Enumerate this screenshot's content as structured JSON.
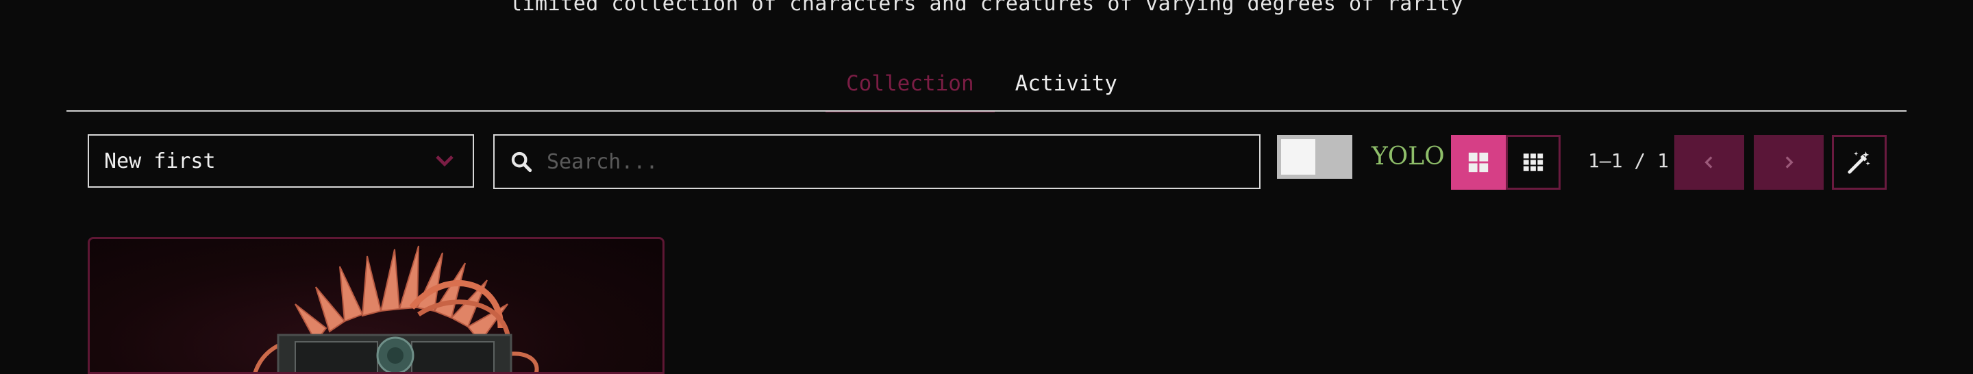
{
  "header": {
    "subtitle": "limited collection of characters and creatures of varying degrees of rarity"
  },
  "tabs": [
    {
      "label": "Collection",
      "active": true
    },
    {
      "label": "Activity",
      "active": false
    }
  ],
  "toolbar": {
    "sort": {
      "selected": "New first",
      "icon": "chevron-down-icon"
    },
    "search": {
      "placeholder": "Search...",
      "value": "",
      "icon": "search-icon"
    },
    "yolo_toggle": {
      "label": "YOLO",
      "on": false
    },
    "view_modes": [
      {
        "name": "large-grid",
        "icon": "grid-large-icon",
        "active": true
      },
      {
        "name": "small-grid",
        "icon": "grid-small-icon",
        "active": false
      }
    ],
    "pagination": {
      "text": "1–1 / 1",
      "prev_icon": "chevron-left-icon",
      "next_icon": "chevron-right-icon"
    },
    "wand_icon": "magic-wand-icon"
  },
  "colors": {
    "accent": "#d63f86",
    "accent_dark": "#5a1638",
    "tab_active": "#7a1d44",
    "yolo": "#8fbf6a",
    "background": "#0a0a0a"
  },
  "items": [
    {
      "kind": "character-card",
      "image": "character-with-orange-feather-crest"
    }
  ]
}
